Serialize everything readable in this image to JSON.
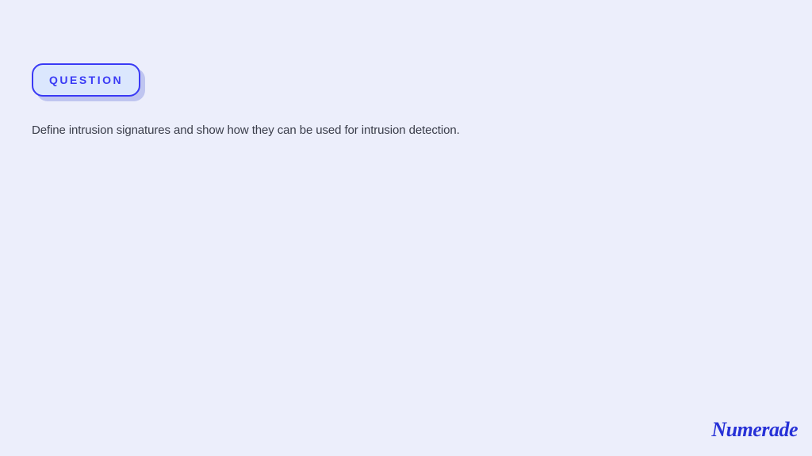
{
  "badge": {
    "label": "QUESTION"
  },
  "question": {
    "text": "Define intrusion signatures and show how they can be used for intrusion detection."
  },
  "brand": {
    "name": "Numerade"
  }
}
